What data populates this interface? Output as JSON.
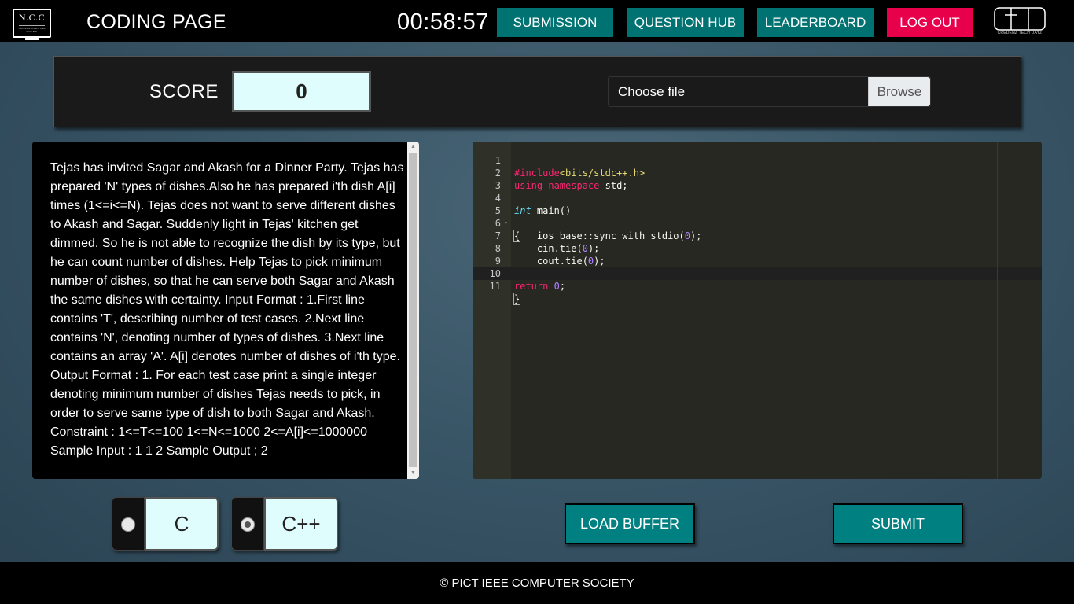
{
  "header": {
    "logo_text": "N.C.C",
    "logo_subtext": "NATIONAL COMPUTING CONTEST",
    "title": "CODING PAGE",
    "timer": "00:58:57",
    "nav": {
      "submission": "SUBMISSION",
      "question_hub": "QUESTION HUB",
      "leaderboard": "LEADERBOARD",
      "logout": "LOG OUT"
    },
    "ctd_logo_text": "CREDENZ TECH DAYZ"
  },
  "score": {
    "label": "SCORE",
    "value": "0"
  },
  "upload": {
    "label": "Choose file",
    "browse": "Browse"
  },
  "question": {
    "text": "Tejas has invited Sagar and Akash for a Dinner Party. Tejas has prepared 'N' types of dishes.Also he has prepared i'th dish A[i] times (1<=i<=N). Tejas does not want to serve different dishes to Akash and Sagar. Suddenly light in Tejas' kitchen get dimmed. So he is not able to recognize the dish by its type, but he can count number of dishes. Help Tejas to pick minimum number of dishes, so that he can serve both Sagar and Akash the same dishes with certainty.  Input Format : 1.First line contains 'T', describing number of test cases. 2.Next line contains 'N', denoting number of types of dishes. 3.Next line contains an array 'A'. A[i] denotes number of dishes of i'th type. Output Format : 1. For each test case print a single integer denoting minimum number of dishes Tejas needs to pick, in order to serve same type of dish to both Sagar and Akash. Constraint : 1<=T<=100 1<=N<=1000 2<=A[i]<=1000000 Sample Input : 1 1 2   Sample Output ; 2"
  },
  "editor": {
    "lines": [
      {
        "num": "1",
        "code": "#include<bits/stdc++.h>"
      },
      {
        "num": "2",
        "code": "using namespace std;"
      },
      {
        "num": "3",
        "code": ""
      },
      {
        "num": "4",
        "code": "int main()"
      },
      {
        "num": "5",
        "code": "{"
      },
      {
        "num": "6",
        "code": "    ios_base::sync_with_stdio(0);"
      },
      {
        "num": "7",
        "code": "    cin.tie(0);"
      },
      {
        "num": "8",
        "code": "    cout.tie(0);"
      },
      {
        "num": "9",
        "code": ""
      },
      {
        "num": "10",
        "code": "return 0;"
      },
      {
        "num": "11",
        "code": "}"
      }
    ]
  },
  "languages": {
    "c": {
      "label": "C",
      "selected": false
    },
    "cpp": {
      "label": "C++",
      "selected": true
    }
  },
  "actions": {
    "load_buffer": "LOAD BUFFER",
    "submit": "SUBMIT"
  },
  "footer": {
    "text": "© PICT IEEE COMPUTER SOCIETY"
  }
}
